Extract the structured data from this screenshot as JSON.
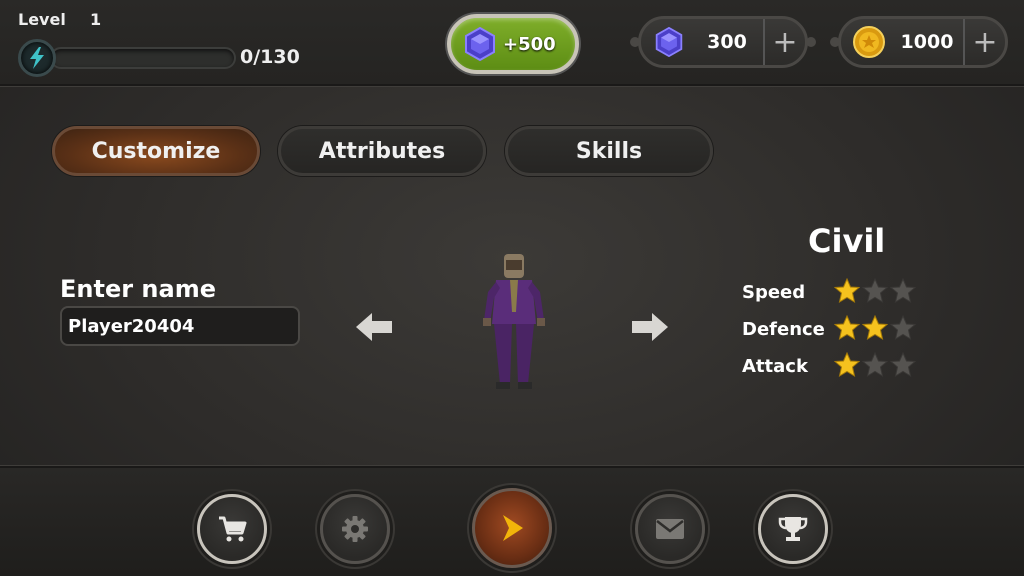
{
  "header": {
    "level_label": "Level",
    "level_value": "1",
    "xp_text": "0/130",
    "xp_progress": 0,
    "gem_offer_label": "+500",
    "gems_amount": "300",
    "coins_amount": "1000",
    "plus_symbol": "+"
  },
  "tabs": [
    {
      "label": "Customize",
      "active": true
    },
    {
      "label": "Attributes",
      "active": false
    },
    {
      "label": "Skills",
      "active": false
    }
  ],
  "name_panel": {
    "label": "Enter name",
    "value": "Player20404"
  },
  "character": {
    "class_name": "Civil",
    "stats": [
      {
        "label": "Speed",
        "stars": 1,
        "max": 3
      },
      {
        "label": "Defence",
        "stars": 2,
        "max": 3
      },
      {
        "label": "Attack",
        "stars": 1,
        "max": 3
      }
    ]
  },
  "bottom_nav": [
    "cart-icon",
    "gear-icon",
    "play-icon",
    "mail-icon",
    "trophy-icon"
  ],
  "colors": {
    "active_tab": "#7a3f1c",
    "gem_offer": "#6f9e1e",
    "gem": "#5b4fd8",
    "coin": "#e8b020",
    "star_on": "#f5c21e",
    "star_off": "#555350",
    "play_arrow": "#f2b40a"
  }
}
